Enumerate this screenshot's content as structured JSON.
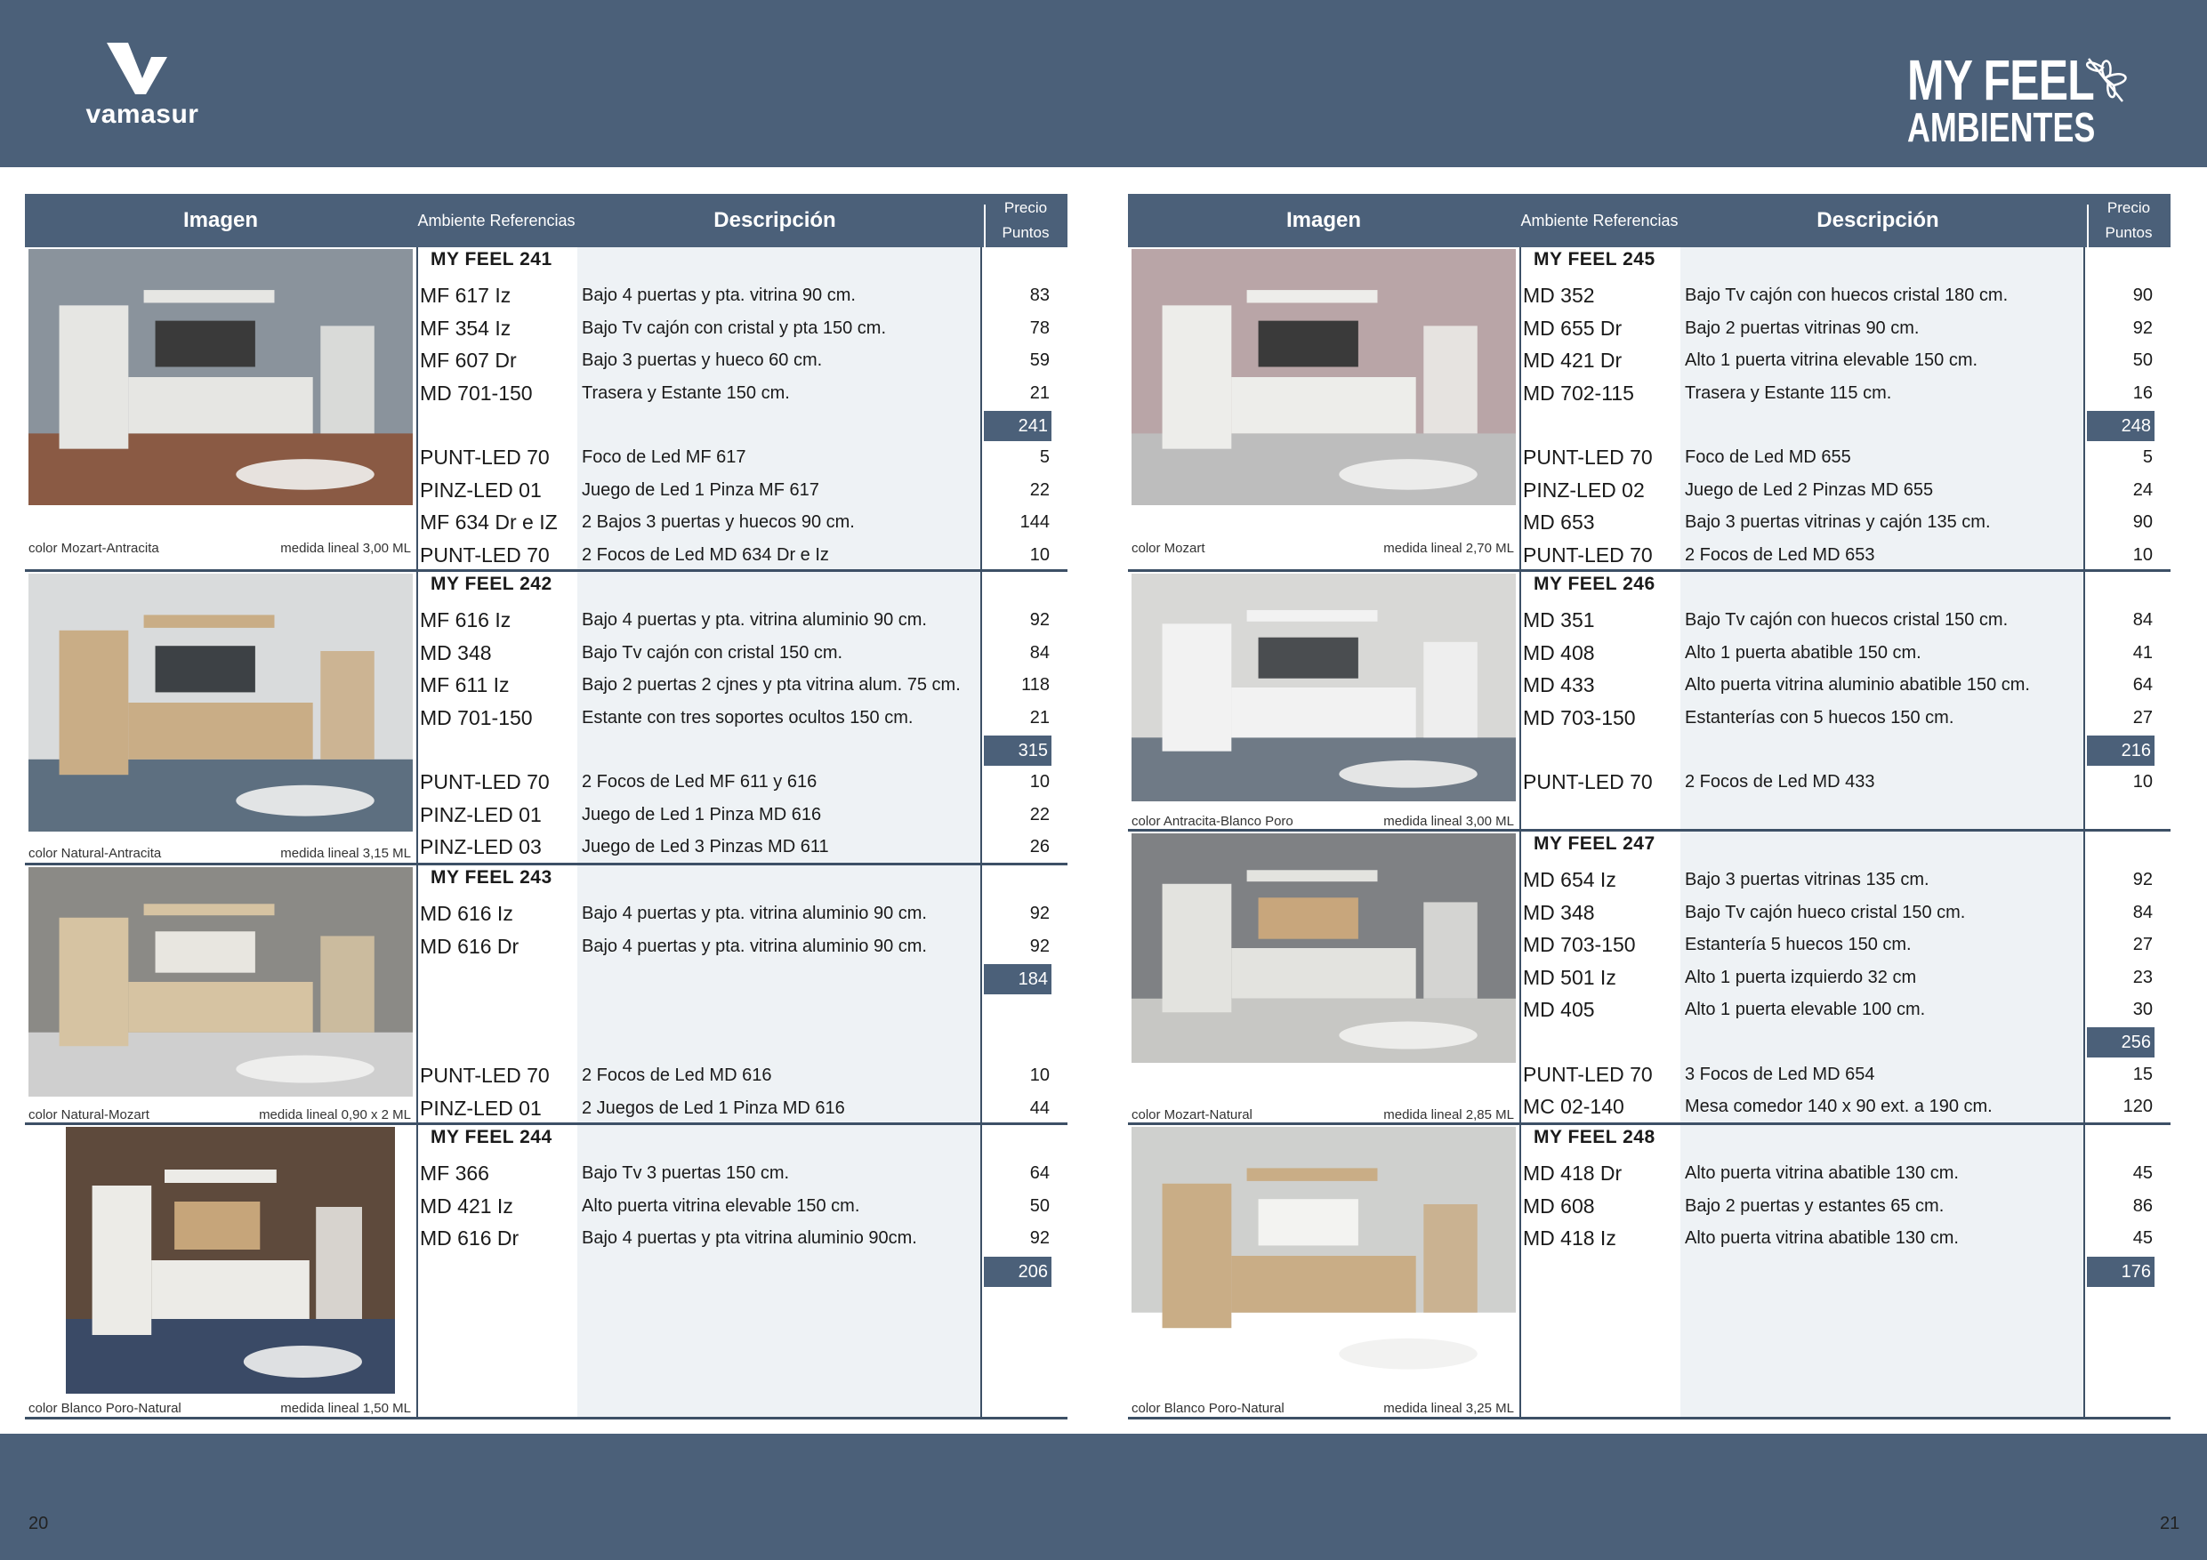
{
  "brand": {
    "name": "vamasur"
  },
  "series": {
    "line1": "MY FEEL",
    "line2": "AMBIENTES"
  },
  "table_headers": {
    "image": "Imagen",
    "refs": "Ambiente Referencias",
    "desc": "Descripción",
    "price1": "Precio",
    "price2": "Puntos"
  },
  "pages": {
    "left": "20",
    "right": "21"
  },
  "left_groups": [
    {
      "title": "MY FEEL 241",
      "color": "color Mozart-Antracita",
      "measure": "medida lineal 3,00 ML",
      "total": "241",
      "items": [
        {
          "ref": "MF 617 Iz",
          "desc": "Bajo 4 puertas y pta. vitrina 90 cm.",
          "price": "83"
        },
        {
          "ref": "MF 354 Iz",
          "desc": "Bajo Tv cajón con cristal y pta 150 cm.",
          "price": "78"
        },
        {
          "ref": "MF 607 Dr",
          "desc": "Bajo 3 puertas y hueco 60 cm.",
          "price": "59"
        },
        {
          "ref": "MD 701-150",
          "desc": "Trasera y Estante 150 cm.",
          "price": "21"
        }
      ],
      "extras": [
        {
          "ref": "PUNT-LED 70",
          "desc": "Foco de Led MF 617",
          "price": "5"
        },
        {
          "ref": "PINZ-LED 01",
          "desc": "Juego de Led 1 Pinza MF 617",
          "price": "22"
        },
        {
          "ref": "MF 634 Dr e IZ",
          "desc": "2 Bajos 3 puertas y huecos 90 cm.",
          "price": "144"
        },
        {
          "ref": "PUNT-LED 70",
          "desc": "2 Focos de Led MD 634 Dr e Iz",
          "price": "10"
        }
      ]
    },
    {
      "title": "MY FEEL 242",
      "color": "color Natural-Antracita",
      "measure": "medida lineal 3,15 ML",
      "total": "315",
      "items": [
        {
          "ref": "MF 616 Iz",
          "desc": "Bajo 4 puertas y pta. vitrina aluminio 90 cm.",
          "price": "92"
        },
        {
          "ref": "MD 348",
          "desc": "Bajo Tv cajón con cristal 150 cm.",
          "price": "84"
        },
        {
          "ref": "MF 611 Iz",
          "desc": "Bajo 2 puertas 2 cjnes y pta vitrina alum. 75 cm.",
          "price": "118"
        },
        {
          "ref": "MD 701-150",
          "desc": "Estante con tres soportes ocultos 150 cm.",
          "price": "21"
        }
      ],
      "extras": [
        {
          "ref": "PUNT-LED 70",
          "desc": "2 Focos de Led MF 611 y 616",
          "price": "10"
        },
        {
          "ref": "PINZ-LED 01",
          "desc": "Juego de Led 1 Pinza MD 616",
          "price": "22"
        },
        {
          "ref": "PINZ-LED 03",
          "desc": "Juego de Led 3 Pinzas MD 611",
          "price": "26"
        }
      ]
    },
    {
      "title": "MY FEEL 243",
      "color": "color Natural-Mozart",
      "measure": "medida lineal 0,90 x 2 ML",
      "total": "184",
      "items": [
        {
          "ref": "MD 616 Iz",
          "desc": "Bajo 4 puertas y pta. vitrina aluminio 90 cm.",
          "price": "92"
        },
        {
          "ref": "MD 616 Dr",
          "desc": "Bajo 4 puertas y pta. vitrina aluminio 90 cm.",
          "price": "92"
        }
      ],
      "extras": [
        {
          "ref": "PUNT-LED 70",
          "desc": "2 Focos de Led MD 616",
          "price": "10"
        },
        {
          "ref": "PINZ-LED 01",
          "desc": "2 Juegos de Led 1 Pinza MD 616",
          "price": "44"
        }
      ]
    },
    {
      "title": "MY FEEL 244",
      "color": "color Blanco Poro-Natural",
      "measure": "medida lineal 1,50 ML",
      "total": "206",
      "items": [
        {
          "ref": "MF 366",
          "desc": "Bajo Tv 3 puertas 150 cm.",
          "price": "64"
        },
        {
          "ref": "MD 421 Iz",
          "desc": "Alto puerta vitrina elevable 150 cm.",
          "price": "50"
        },
        {
          "ref": "MD 616 Dr",
          "desc": "Bajo 4 puertas y pta vitrina aluminio 90cm.",
          "price": "92"
        }
      ],
      "extras": []
    }
  ],
  "right_groups": [
    {
      "title": "MY FEEL 245",
      "color": "color Mozart",
      "measure": "medida lineal 2,70 ML",
      "total": "248",
      "items": [
        {
          "ref": "MD 352",
          "desc": "Bajo Tv cajón con huecos cristal 180 cm.",
          "price": "90"
        },
        {
          "ref": "MD 655 Dr",
          "desc": "Bajo 2 puertas vitrinas 90 cm.",
          "price": "92"
        },
        {
          "ref": "MD 421 Dr",
          "desc": "Alto 1 puerta vitrina elevable 150 cm.",
          "price": "50"
        },
        {
          "ref": "MD 702-115",
          "desc": "Trasera y Estante 115 cm.",
          "price": "16"
        }
      ],
      "extras": [
        {
          "ref": "PUNT-LED 70",
          "desc": "Foco de Led MD 655",
          "price": "5"
        },
        {
          "ref": "PINZ-LED 02",
          "desc": "Juego de Led 2 Pinzas MD 655",
          "price": "24"
        },
        {
          "ref": "MD 653",
          "desc": "Bajo 3 puertas vitrinas y cajón 135 cm.",
          "price": "90"
        },
        {
          "ref": "PUNT-LED 70",
          "desc": "2 Focos de Led MD 653",
          "price": "10"
        }
      ]
    },
    {
      "title": "MY FEEL 246",
      "color": "color Antracita-Blanco Poro",
      "measure": "medida lineal 3,00 ML",
      "total": "216",
      "items": [
        {
          "ref": "MD 351",
          "desc": "Bajo Tv cajón con huecos cristal 150 cm.",
          "price": "84"
        },
        {
          "ref": "MD 408",
          "desc": "Alto 1 puerta abatible 150 cm.",
          "price": "41"
        },
        {
          "ref": "MD 433",
          "desc": "Alto puerta vitrina aluminio abatible 150 cm.",
          "price": "64"
        },
        {
          "ref": "MD 703-150",
          "desc": "Estanterías con 5 huecos 150 cm.",
          "price": "27"
        }
      ],
      "extras": [
        {
          "ref": "PUNT-LED 70",
          "desc": "2 Focos de Led MD 433",
          "price": "10"
        }
      ]
    },
    {
      "title": "MY FEEL 247",
      "color": "color Mozart-Natural",
      "measure": "medida lineal 2,85 ML",
      "total": "256",
      "items": [
        {
          "ref": "MD 654 Iz",
          "desc": "Bajo 3 puertas vitrinas 135 cm.",
          "price": "92"
        },
        {
          "ref": "MD 348",
          "desc": "Bajo Tv cajón hueco cristal 150 cm.",
          "price": "84"
        },
        {
          "ref": "MD 703-150",
          "desc": "Estantería 5 huecos 150 cm.",
          "price": "27"
        },
        {
          "ref": "MD 501 Iz",
          "desc": "Alto 1 puerta izquierdo 32 cm",
          "price": "23"
        },
        {
          "ref": "MD 405",
          "desc": "Alto 1 puerta elevable 100 cm.",
          "price": "30"
        }
      ],
      "extras": [
        {
          "ref": "PUNT-LED 70",
          "desc": "3 Focos de Led MD 654",
          "price": "15"
        },
        {
          "ref": "MC 02-140",
          "desc": "Mesa comedor 140 x 90 ext. a 190 cm.",
          "price": "120"
        }
      ]
    },
    {
      "title": "MY FEEL 248",
      "color": "color Blanco Poro-Natural",
      "measure": "medida lineal 3,25 ML",
      "total": "176",
      "items": [
        {
          "ref": "MD 418 Dr",
          "desc": "Alto puerta vitrina abatible 130 cm.",
          "price": "45"
        },
        {
          "ref": "MD 608",
          "desc": "Bajo 2 puertas y estantes 65 cm.",
          "price": "86"
        },
        {
          "ref": "MD 418 Iz",
          "desc": "Alto puerta vitrina abatible 130 cm.",
          "price": "45"
        }
      ],
      "extras": []
    }
  ]
}
